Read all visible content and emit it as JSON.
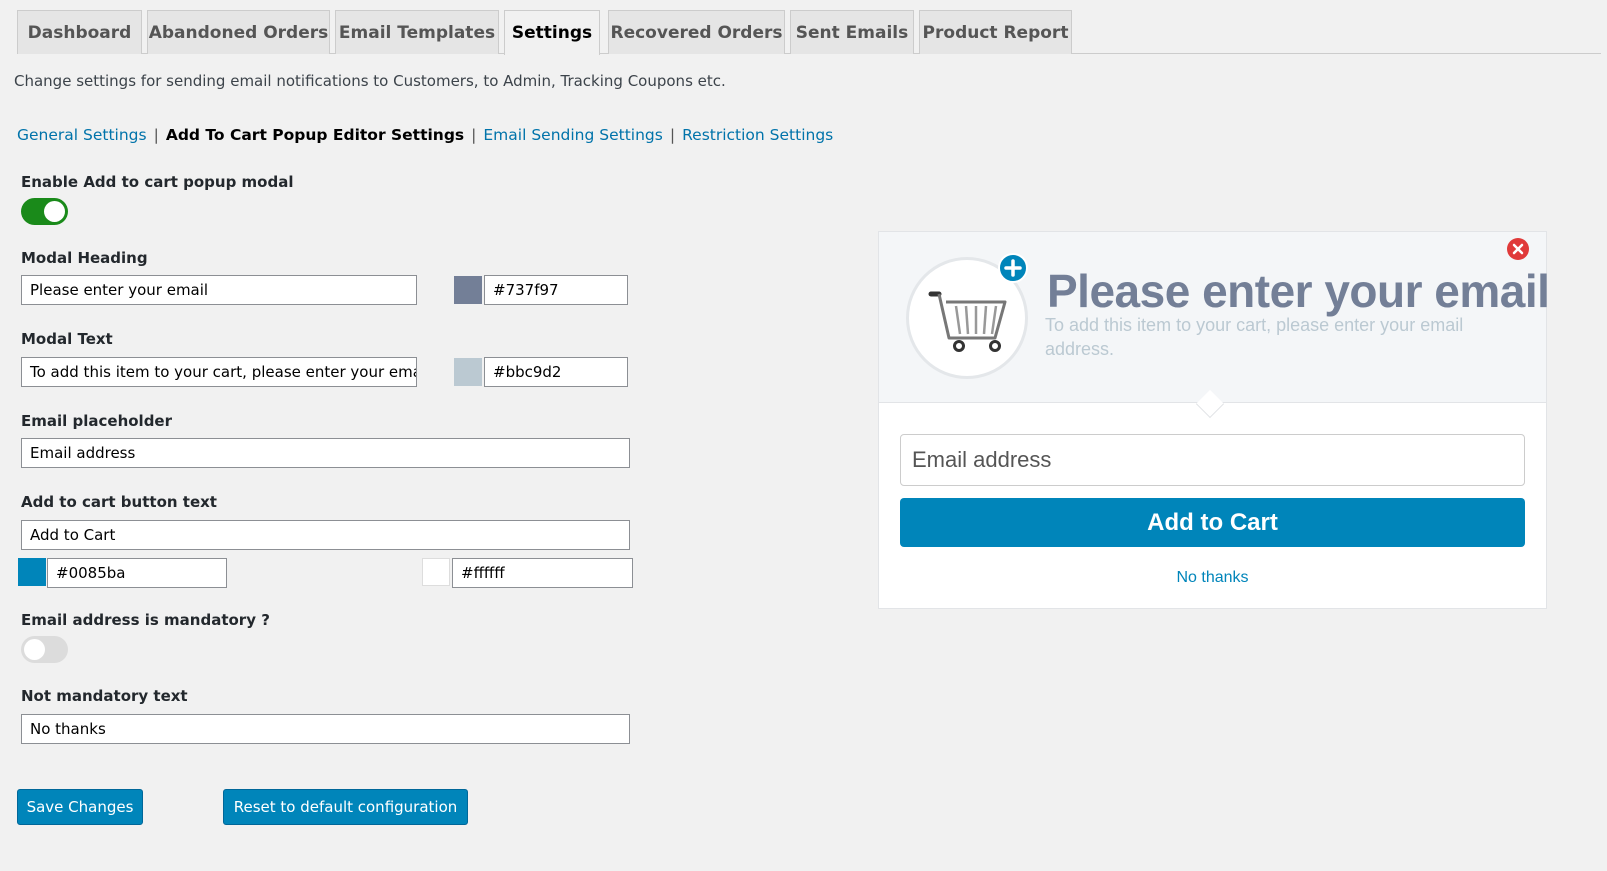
{
  "tabs": [
    {
      "label": "Dashboard",
      "active": false
    },
    {
      "label": "Abandoned Orders",
      "active": false
    },
    {
      "label": "Email Templates",
      "active": false
    },
    {
      "label": "Settings",
      "active": true
    },
    {
      "label": "Recovered Orders",
      "active": false
    },
    {
      "label": "Sent Emails",
      "active": false
    },
    {
      "label": "Product Report",
      "active": false
    }
  ],
  "intro_text": "Change settings for sending email notifications to Customers, to Admin, Tracking Coupons etc.",
  "subnav": {
    "items": [
      "General Settings",
      "Add To Cart Popup Editor Settings",
      "Email Sending Settings",
      "Restriction Settings"
    ],
    "current": 1,
    "separator": "|"
  },
  "form": {
    "enable_modal": {
      "label": "Enable Add to cart popup modal",
      "enabled": true
    },
    "modal_heading": {
      "label": "Modal Heading",
      "value": "Please enter your email",
      "color": "#737f97"
    },
    "modal_text": {
      "label": "Modal Text",
      "value": "To add this item to your cart, please enter your email",
      "color": "#bbc9d2"
    },
    "email_placeholder": {
      "label": "Email placeholder",
      "value": "Email address"
    },
    "button_text": {
      "label": "Add to cart button text",
      "value": "Add to Cart",
      "bg_color": "#0085ba",
      "text_color": "#ffffff"
    },
    "email_mandatory": {
      "label": "Email address is mandatory ?",
      "enabled": false
    },
    "not_mandatory_text": {
      "label": "Not mandatory text",
      "value": "No thanks"
    }
  },
  "buttons": {
    "save": "Save Changes",
    "reset": "Reset to default configuration"
  },
  "preview": {
    "heading": "Please enter your email",
    "text": "To add this item to your cart, please enter your email address.",
    "email_placeholder": "Email address",
    "button_label": "Add to Cart",
    "no_thanks": "No thanks",
    "icons": {
      "cart": "shopping-cart-icon",
      "plus": "plus-icon",
      "close": "close-icon"
    }
  }
}
